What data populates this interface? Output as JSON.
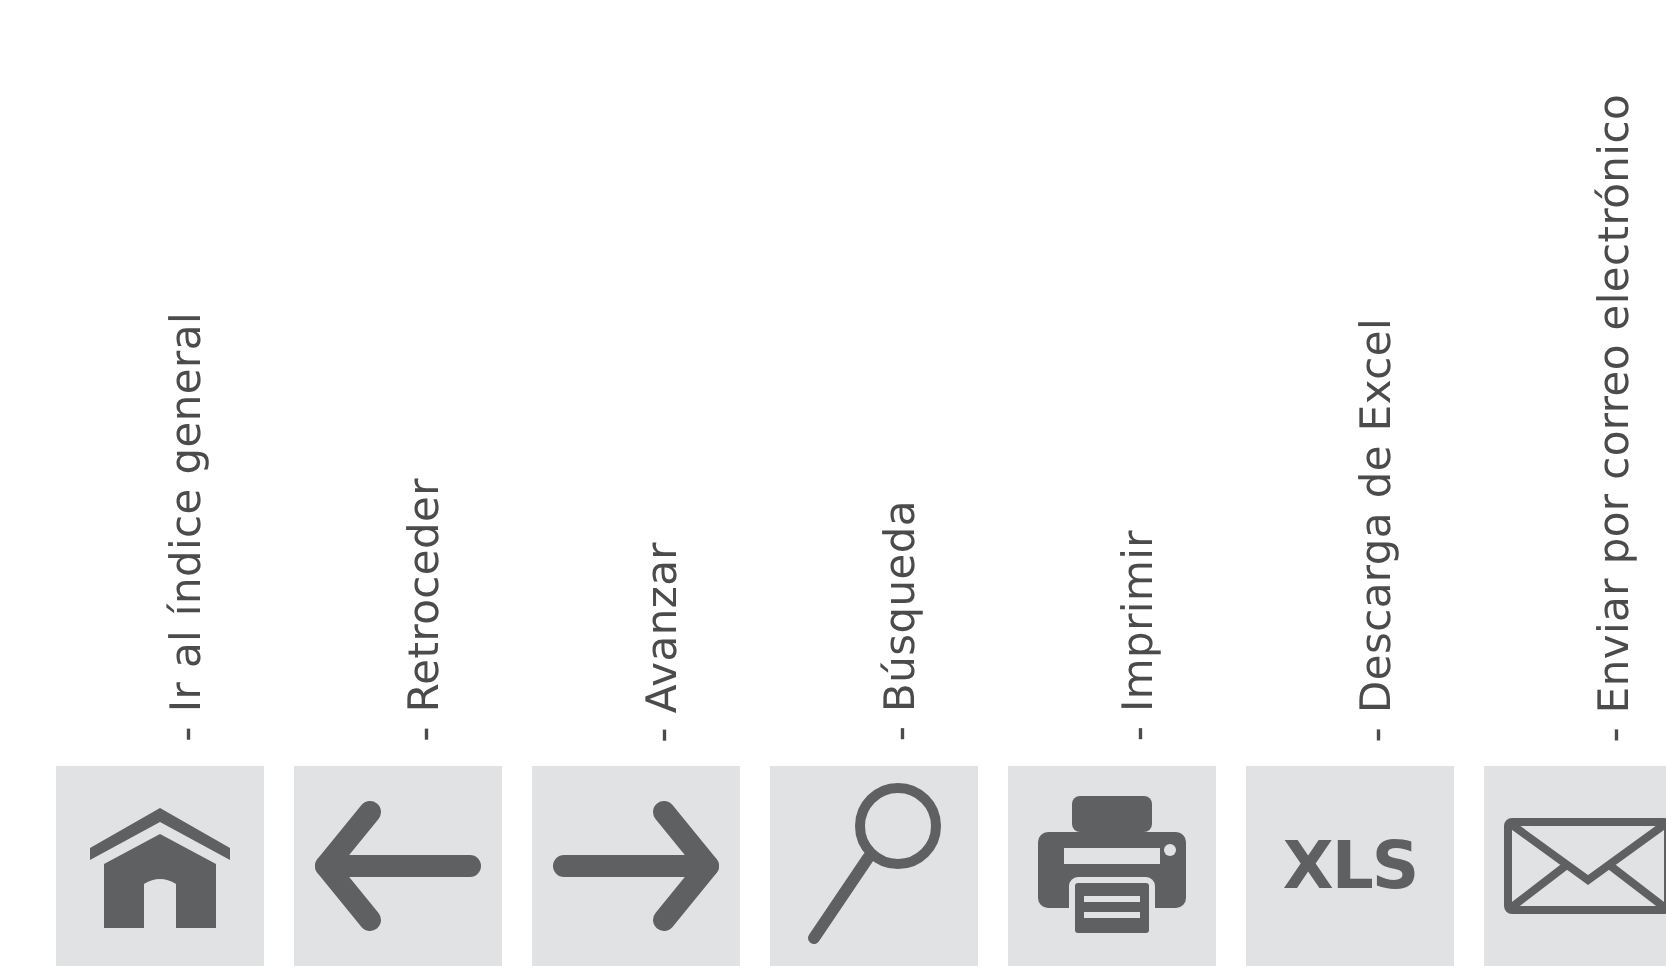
{
  "items": [
    {
      "label": "- Ir al índice general",
      "kind": "home"
    },
    {
      "label": "- Retroceder",
      "kind": "back"
    },
    {
      "label": "- Avanzar",
      "kind": "forward"
    },
    {
      "label": "- Búsqueda",
      "kind": "search"
    },
    {
      "label": "- Imprimir",
      "kind": "print"
    },
    {
      "label": "- Descarga de Excel",
      "kind": "text",
      "text": "XLS"
    },
    {
      "label": "- Enviar por correo electrónico",
      "kind": "mail"
    }
  ]
}
